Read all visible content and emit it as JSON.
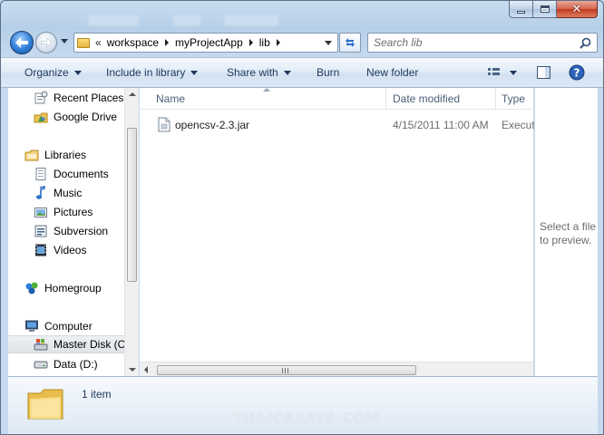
{
  "window": {
    "title_ghost": [
      "workspace",
      "Burn",
      "New folder"
    ],
    "colors": {
      "frame": "#b6cfe8",
      "accent": "#1e395b",
      "close": "#c13a1f"
    }
  },
  "navigation": {
    "breadcrumb_overflow": "«",
    "breadcrumbs": [
      "workspace",
      "myProjectApp",
      "lib"
    ],
    "search_placeholder": "Search lib"
  },
  "toolbar": {
    "organize": "Organize",
    "include_in_library": "Include in library",
    "share_with": "Share with",
    "burn": "Burn",
    "new_folder": "New folder"
  },
  "sidebar": {
    "items": [
      {
        "label": "Recent Places",
        "icon": "recent-places-icon"
      },
      {
        "label": "Google Drive",
        "icon": "google-drive-icon"
      },
      {
        "label": "Libraries",
        "icon": "libraries-icon"
      },
      {
        "label": "Documents",
        "icon": "documents-icon"
      },
      {
        "label": "Music",
        "icon": "music-icon"
      },
      {
        "label": "Pictures",
        "icon": "pictures-icon"
      },
      {
        "label": "Subversion",
        "icon": "subversion-icon"
      },
      {
        "label": "Videos",
        "icon": "videos-icon"
      },
      {
        "label": "Homegroup",
        "icon": "homegroup-icon"
      },
      {
        "label": "Computer",
        "icon": "computer-icon"
      },
      {
        "label": "Master Disk (C",
        "icon": "master-disk-icon",
        "selected": true
      },
      {
        "label": "Data (D:)",
        "icon": "drive-icon"
      }
    ]
  },
  "file_list": {
    "columns": [
      "Name",
      "Date modified",
      "Type"
    ],
    "rows": [
      {
        "name": "opencsv-2.3.jar",
        "date": "4/15/2011 11:00 AM",
        "type": "Execut"
      }
    ]
  },
  "preview": {
    "text": "Select a file to preview."
  },
  "details": {
    "item_count": "1 item",
    "watermark": "THAICREATE.COM"
  }
}
